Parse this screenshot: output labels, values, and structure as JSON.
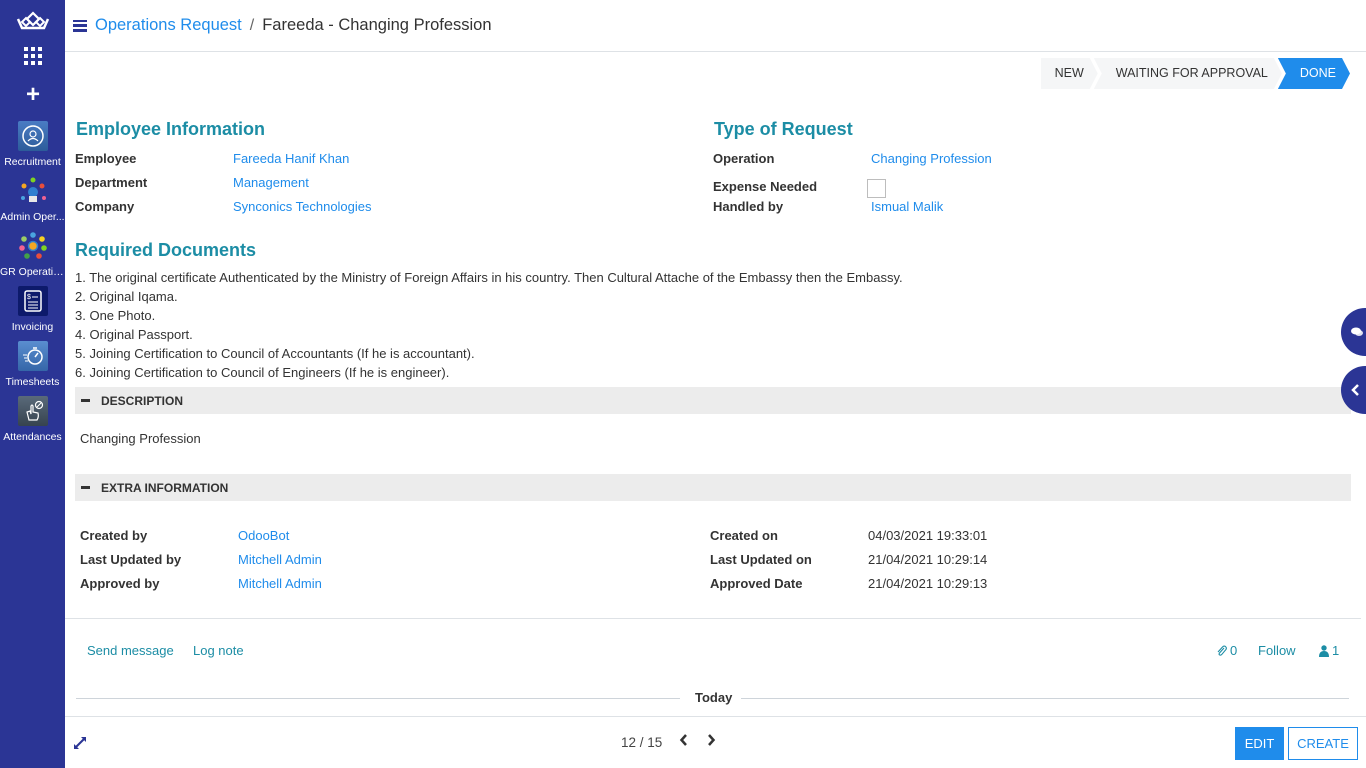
{
  "sidebar": {
    "logo_icon": "crown-logo-icon",
    "apps_menu_icon": "apps-grid-icon",
    "new_icon": "plus-icon",
    "apps": [
      {
        "label": "Recruitment",
        "icon": "recruitment-icon",
        "color": "#3d6fb8"
      },
      {
        "label": "Admin Oper...",
        "icon": "admin-operations-icon",
        "color": "#2b3595"
      },
      {
        "label": "GR Operatio...",
        "icon": "gr-operations-icon",
        "color": "#2b3595"
      },
      {
        "label": "Invoicing",
        "icon": "invoicing-icon",
        "color": "#0d1a6b"
      },
      {
        "label": "Timesheets",
        "icon": "timesheets-icon",
        "color": "#3d6fb8"
      },
      {
        "label": "Attendances",
        "icon": "attendances-icon",
        "color": "#3a4a5a"
      }
    ]
  },
  "header": {
    "breadcrumb_parent": "Operations Request",
    "breadcrumb_separator": "/",
    "breadcrumb_current": "Fareeda - Changing Profession"
  },
  "status": {
    "stages": [
      "NEW",
      "WAITING FOR APPROVAL",
      "DONE"
    ],
    "active": "DONE"
  },
  "employee_info": {
    "title": "Employee Information",
    "fields": [
      {
        "label": "Employee",
        "value": "Fareeda Hanif Khan"
      },
      {
        "label": "Department",
        "value": "Management"
      },
      {
        "label": "Company",
        "value": "Synconics Technologies"
      }
    ]
  },
  "type_of_request": {
    "title": "Type of Request",
    "operation_label": "Operation",
    "operation_value": "Changing Profession",
    "expense_label": "Expense Needed",
    "expense_checked": false,
    "handled_label": "Handled by",
    "handled_value": "Ismual Malik"
  },
  "required_documents": {
    "title": "Required Documents",
    "items": [
      "1. The original certificate Authenticated by the Ministry of Foreign Affairs in his country. Then Cultural Attache of the Embassy then the Embassy.",
      "2. Original Iqama.",
      "3. One Photo.",
      "4. Original Passport.",
      "5. Joining Certification to Council of Accountants (If he is accountant).",
      "6. Joining Certification to Council of Engineers (If he is engineer)."
    ]
  },
  "description": {
    "header": "DESCRIPTION",
    "text": "Changing Profession"
  },
  "extra_info": {
    "header": "EXTRA INFORMATION",
    "created_by_label": "Created by",
    "created_by": "OdooBot",
    "last_updated_by_label": "Last Updated by",
    "last_updated_by": "Mitchell Admin",
    "approved_by_label": "Approved by",
    "approved_by": "Mitchell Admin",
    "created_on_label": "Created on",
    "created_on": "04/03/2021 19:33:01",
    "last_updated_on_label": "Last Updated on",
    "last_updated_on": "21/04/2021 10:29:14",
    "approved_date_label": "Approved Date",
    "approved_date": "21/04/2021 10:29:13"
  },
  "chatter": {
    "send_message": "Send message",
    "log_note": "Log note",
    "attachments_count": "0",
    "follow": "Follow",
    "followers_count": "1",
    "today": "Today"
  },
  "pager": {
    "value": "12 / 15"
  },
  "actions": {
    "edit": "EDIT",
    "create": "CREATE"
  },
  "colors": {
    "sidebar": "#2b3595",
    "link": "#1f8ceb",
    "section_title": "#1c8da5",
    "active_stage": "#1f8ceb"
  }
}
